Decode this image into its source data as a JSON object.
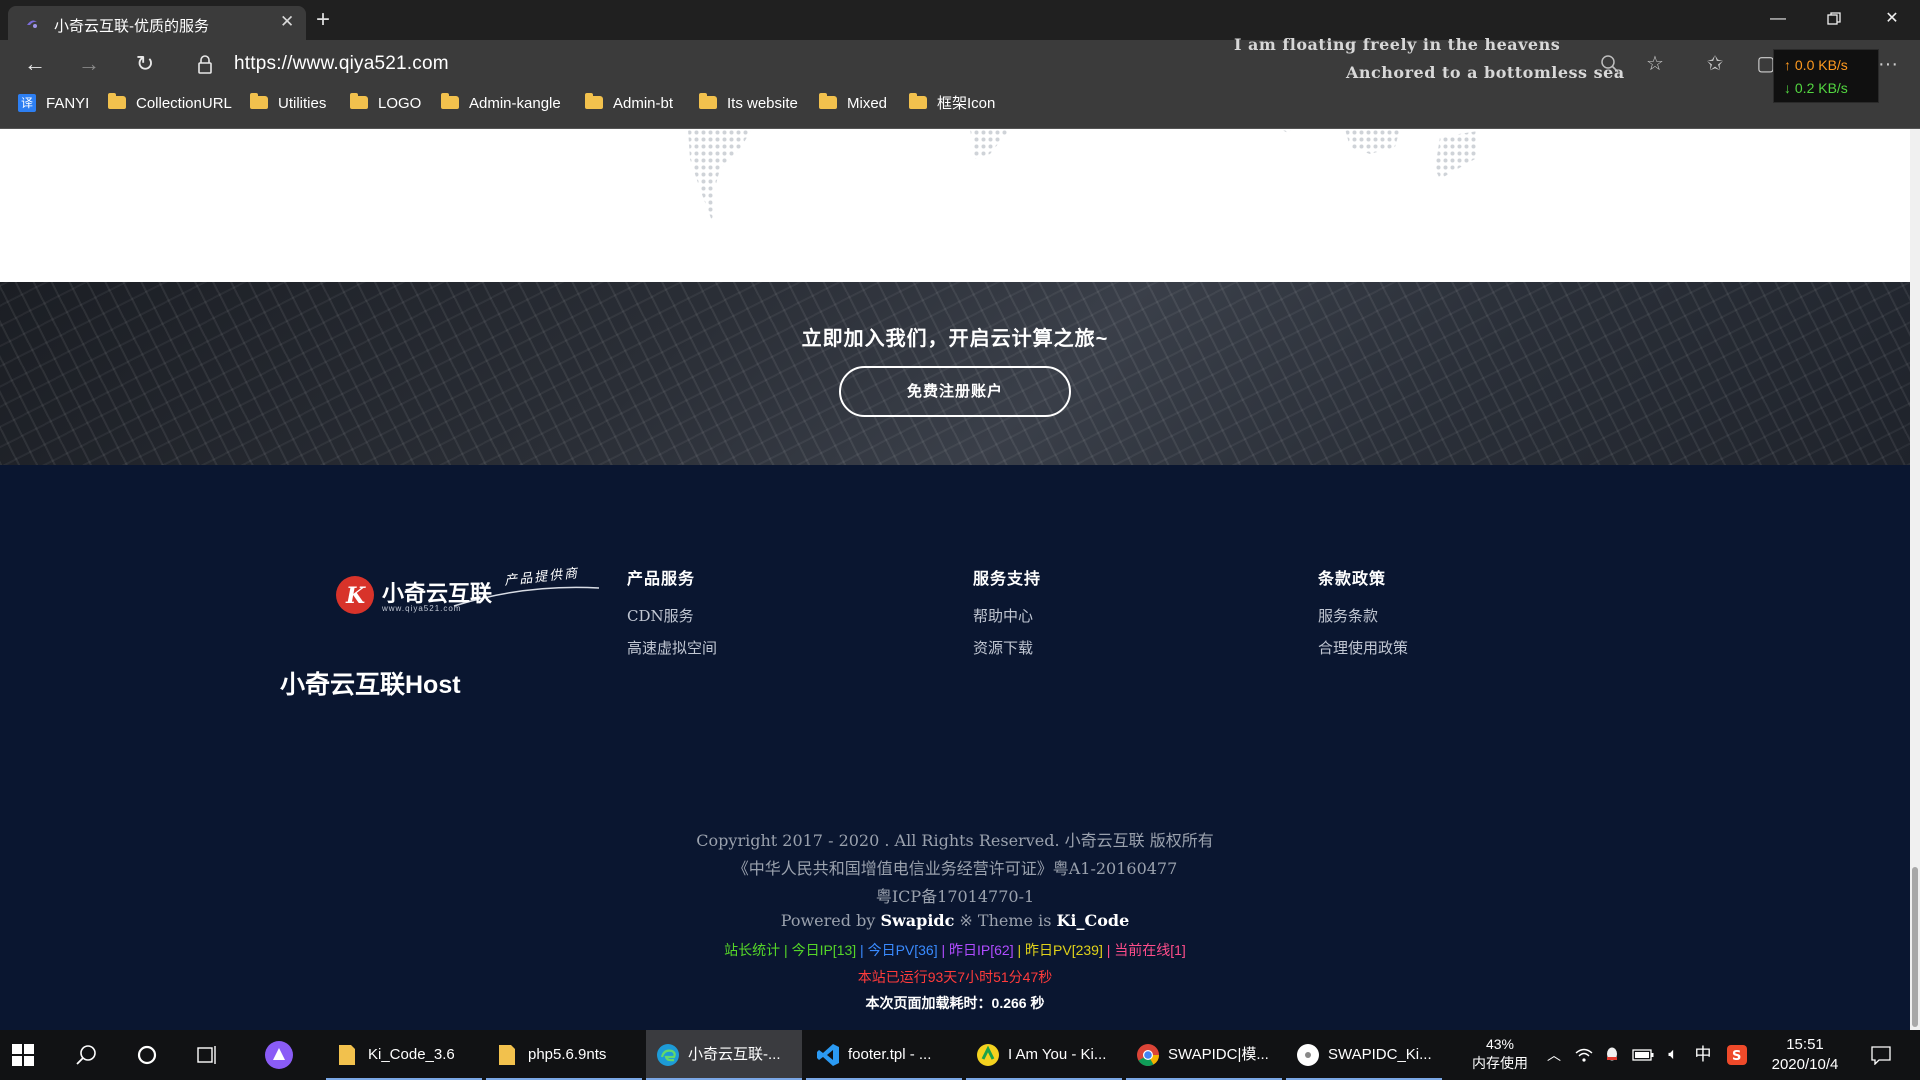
{
  "browser": {
    "tab_title": "小奇云互联-优质的服务",
    "url": "https://www.qiya521.com",
    "lyrics_line1": "I am floating freely in the heavens",
    "lyrics_line2": "Anchored to a bottomless sea",
    "net_up": "↑ 0.0 KB/s",
    "net_down": "↓ 0.2 KB/s"
  },
  "bookmarks": [
    "FANYI",
    "CollectionURL",
    "Utilities",
    "LOGO",
    "Admin-kangle",
    "Admin-bt",
    "Its website",
    "Mixed",
    "框架Icon"
  ],
  "hero": {
    "title": "立即加入我们，开启云计算之旅~",
    "button": "免费注册账户"
  },
  "footer": {
    "logo_text": "小奇云互联",
    "logo_tagline": "产品提供商",
    "logo_url": "www.qiya521.com",
    "host_name": "小奇云互联Host",
    "columns": [
      {
        "title": "产品服务",
        "links": [
          "CDN服务",
          "高速虚拟空间"
        ]
      },
      {
        "title": "服务支持",
        "links": [
          "帮助中心",
          "资源下载"
        ]
      },
      {
        "title": "条款政策",
        "links": [
          "服务条款",
          "合理使用政策"
        ]
      }
    ],
    "copyright": "Copyright 2017 - 2020 . All Rights Reserved. 小奇云互联 版权所有",
    "license": "《中华人民共和国增值电信业务经营许可证》粤A1-20160477",
    "icp": "粤ICP备17014770-1",
    "powered_prefix": "Powered by",
    "powered_name": "Swapidc",
    "theme_prefix": "※ Theme is",
    "theme_name": "Ki_Code",
    "stats": [
      {
        "text": "站长统计",
        "color": "#55d628"
      },
      {
        "text": " | 今日IP[13] ",
        "color": "#55d628"
      },
      {
        "text": "| 今日PV[36] ",
        "color": "#3a8bff"
      },
      {
        "text": "| 昨日IP[62] ",
        "color": "#b04cff"
      },
      {
        "text": "| 昨日PV[239] ",
        "color": "#e0d21a"
      },
      {
        "text": "| 当前在线[1]",
        "color": "#ff4d8a"
      }
    ],
    "uptime": "本站已运行93天7小时51分47秒",
    "load_time": "本次页面加载耗时：0.266 秒"
  },
  "taskbar": {
    "tasks": [
      "Ki_Code_3.6",
      "php5.6.9nts",
      "小奇云互联-...",
      "footer.tpl - ...",
      "I Am You - Ki...",
      "SWAPIDC|模...",
      "SWAPIDC_Ki..."
    ],
    "mem_percent": "43%",
    "mem_label": "内存使用",
    "ime": "中",
    "time": "15:51",
    "date": "2020/10/4"
  }
}
